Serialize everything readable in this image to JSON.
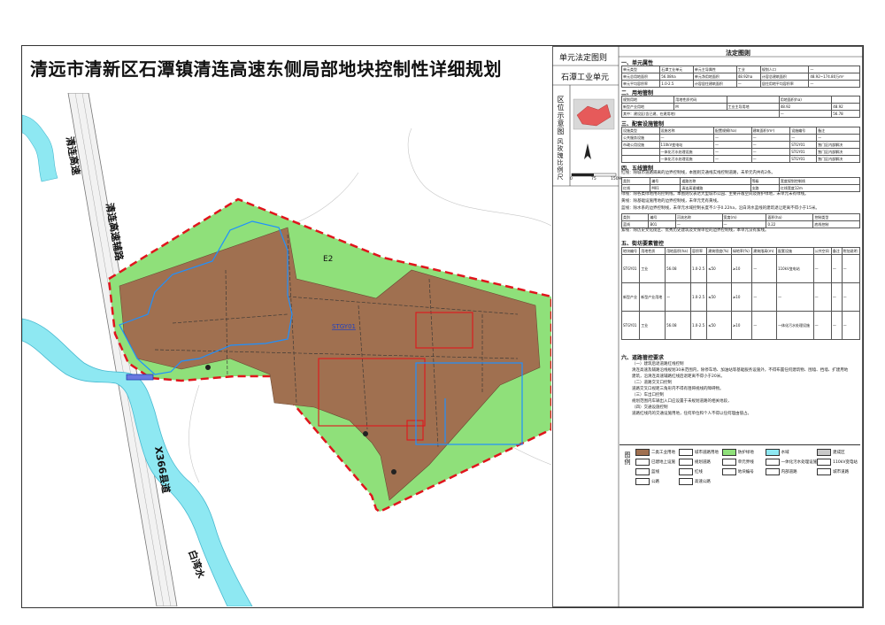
{
  "title": "清远市清新区石潭镇清连高速东侧局部地块控制性详细规划",
  "map_labels": {
    "highway": "清连高速",
    "aux_road": "清连高速辅路",
    "county_road": "X366县道",
    "river": "白湾水",
    "zone_e2": "E2",
    "plot_id": "STGY01"
  },
  "right_header": {
    "unit_map": "单元法定图则",
    "unit_name": "石潭工业单元",
    "location_label": "区位示意图",
    "wind_label": "风玫瑰比例尺",
    "scale_ticks": [
      "0",
      "75",
      "150M"
    ],
    "legal_title": "法定图则"
  },
  "sections": [
    "一、单元属性",
    "二、用地管制",
    "三、配套设施管制",
    "四、五线管制",
    "五、街坊要素管控",
    "六、道路管控要求"
  ],
  "unit_attr": {
    "r1": [
      "单元类型",
      "石潭工业单元",
      "单元主导属性",
      "工业",
      "规划人口",
      "—"
    ],
    "r2": [
      "单元总用地面积",
      "56.08ha",
      "单元净用地面积",
      "48.92ha",
      "计容总建筑面积",
      "48.92~174.80万m²"
    ],
    "r3": [
      "单元平均容积率",
      "1.0-2.5",
      "计容居住建筑面积",
      "—",
      "居住用地平均容积率",
      "—"
    ]
  },
  "land_use": {
    "headers": [
      "规划用地",
      "用地性质代码",
      "用地面积(ha)"
    ],
    "row1": [
      "新型产业用地",
      "M",
      "工业主导用地",
      "48.92",
      "48.92"
    ],
    "row2": [
      "其中：建设区(含已建、在建用地)",
      "—",
      "56.78"
    ]
  },
  "facilities": {
    "headers": [
      "设施类型",
      "设施名称",
      "配置规模(ha)",
      "建筑面积(m²)",
      "设施编号",
      "备注"
    ],
    "rows": [
      [
        "公共服务设施",
        "—",
        "—",
        "—",
        "—",
        "—"
      ],
      [
        "市政公用设施",
        "110kV变电站",
        "—",
        "—",
        "STGY01",
        "独门区内部解决"
      ],
      [
        "",
        "一体化污水处理设施",
        "—",
        "—",
        "STGY01",
        "独门区内部解决"
      ],
      [
        "",
        "一体化污水处理设施",
        "—",
        "—",
        "STGY01",
        "独门区内部解决"
      ]
    ]
  },
  "five_lines": {
    "red_line_note": "红线：除城市道路隔离的边界控制线，本图则交通线实线控制道路，未单元内共有2条。",
    "red_headers": [
      "类别",
      "编号",
      "道路名称",
      "等级",
      "宽度规划控制线"
    ],
    "red_row": [
      "红线",
      "M01",
      "清连高速辅路",
      "支路",
      "红线宽度12m"
    ],
    "green_note": "绿线：除各类绿地用的控制线，本图则仅表达大型城市公园、主要开敞空间及防护绿地，未单元未有绿线。",
    "yellow_note": "黄线：除基础设施用地的边界控制线，未单元无有黄线。",
    "blue_note": "蓝线：除水系的边界控制线，未单元水域控制长度不少于0.22ha，沿白湾水蓝线的建筑退让距离不得小于15米。",
    "blue_headers": [
      "类别",
      "编号",
      "河流名称",
      "宽度(m)",
      "面积(ha)",
      "控制类型"
    ],
    "blue_row": [
      "蓝线",
      "B01",
      "—",
      "—",
      "0.22",
      "底线控制"
    ],
    "purple_note": "紫线：除历史文化街区、优秀历史建筑及文保单位的边界控制线，本单元没有紫线。"
  },
  "street_controls": {
    "headers": [
      "地块编号",
      "用地性质",
      "用地面积(ha)",
      "容积率",
      "建筑密度(%)",
      "绿地率(%)",
      "建筑限高(m)",
      "配套设施",
      "公共空间",
      "备注",
      "附加说明"
    ],
    "rows": [
      [
        "STGY01",
        "工业",
        "56.08",
        "1.0-2.5",
        "≤50",
        "≥10",
        "—",
        "110kV变电站",
        "—",
        "—",
        "—"
      ],
      [
        "新型产业",
        "新型产业用地",
        "—",
        "1.0-2.5",
        "≤50",
        "≥10",
        "—",
        "—",
        "—",
        "—",
        "—"
      ],
      [
        "STGY01",
        "工业",
        "56.08",
        "1.0-2.5",
        "≤50",
        "≥10",
        "—",
        "一体化污水处理设施",
        "—",
        "—",
        "—"
      ]
    ]
  },
  "road_controls": {
    "lines": [
      "（一）建筑后退道路红线控制",
      "清连高速及辅路沿线规划30米范围内，除停车场、加油站等基础服务设施外，不得布置任何建筑物、围墙、挡墙、扩建用地",
      "建筑，沿清连高速辅路红线后退距离不得小于20米。",
      "（二）道路交叉口控制",
      "道路交叉口视距三角形内不得有阻碍视线的障碍物。",
      "（三）车出口控制",
      "规划范围内车辆出入口应设置于未规划道路的相关地段，",
      "（四）交通设施控制",
      "道路红线内的交通设施用地，任何单位和个人不得以任何理由侵占。"
    ]
  },
  "legend": {
    "title": "图例",
    "items": [
      {
        "label": "二类工业用地",
        "color": "#a07050"
      },
      {
        "label": "城市道路用地",
        "color": "#ffffff"
      },
      {
        "label": "防护绿地",
        "color": "#8fe07a"
      },
      {
        "label": "水域",
        "color": "#8ee8f2"
      },
      {
        "label": "建成区",
        "color": "#c8c8c8"
      },
      {
        "label": "已建地上设施",
        "color": "#ffffff"
      },
      {
        "label": "规划道路",
        "color": "#ffffff"
      },
      {
        "label": "单元界线",
        "color": "#ffffff"
      },
      {
        "label": "一体化污水处理设施",
        "color": "#ffffff"
      },
      {
        "label": "110kV变电站",
        "color": "#ffffff"
      },
      {
        "label": "蓝线",
        "color": "#ffffff"
      },
      {
        "label": "红线",
        "color": "#ffffff"
      },
      {
        "label": "地块编号",
        "color": "#ffffff"
      },
      {
        "label": "内部道路",
        "color": "#ffffff"
      },
      {
        "label": "城市道路",
        "color": "#ffffff"
      },
      {
        "label": "公路",
        "color": "#ffffff"
      },
      {
        "label": "高速公路",
        "color": "#ffffff"
      }
    ]
  },
  "colors": {
    "industrial": "#a07050",
    "green": "#8fe07a",
    "water": "#8ee8f2",
    "boundary": "#e0151c",
    "blue_line": "#1e90ff"
  }
}
